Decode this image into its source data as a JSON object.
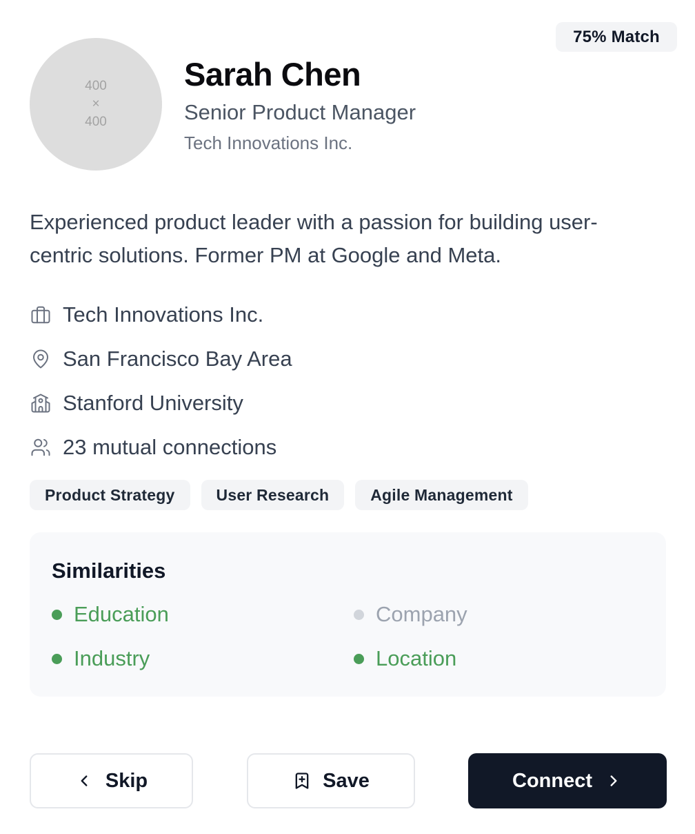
{
  "profile": {
    "match_badge": "75% Match",
    "avatar_placeholder": {
      "line1": "400",
      "line2": "×",
      "line3": "400"
    },
    "name": "Sarah Chen",
    "title": "Senior Product Manager",
    "company": "Tech Innovations Inc.",
    "bio": "Experienced product leader with a passion for building user-centric solutions. Former PM at Google and Meta."
  },
  "info": [
    {
      "icon": "briefcase-icon",
      "text": "Tech Innovations Inc."
    },
    {
      "icon": "map-pin-icon",
      "text": "San Francisco Bay Area"
    },
    {
      "icon": "school-icon",
      "text": "Stanford University"
    },
    {
      "icon": "users-icon",
      "text": "23 mutual connections"
    }
  ],
  "tags": [
    "Product Strategy",
    "User Research",
    "Agile Management"
  ],
  "similarities": {
    "heading": "Similarities",
    "items": [
      {
        "label": "Education",
        "matched": true
      },
      {
        "label": "Company",
        "matched": false
      },
      {
        "label": "Industry",
        "matched": true
      },
      {
        "label": "Location",
        "matched": true
      }
    ]
  },
  "actions": {
    "skip_label": "Skip",
    "save_label": "Save",
    "connect_label": "Connect"
  },
  "colors": {
    "match_green": "#4a9d58",
    "inactive_gray": "#9ca3af",
    "primary_dark": "#111827"
  }
}
